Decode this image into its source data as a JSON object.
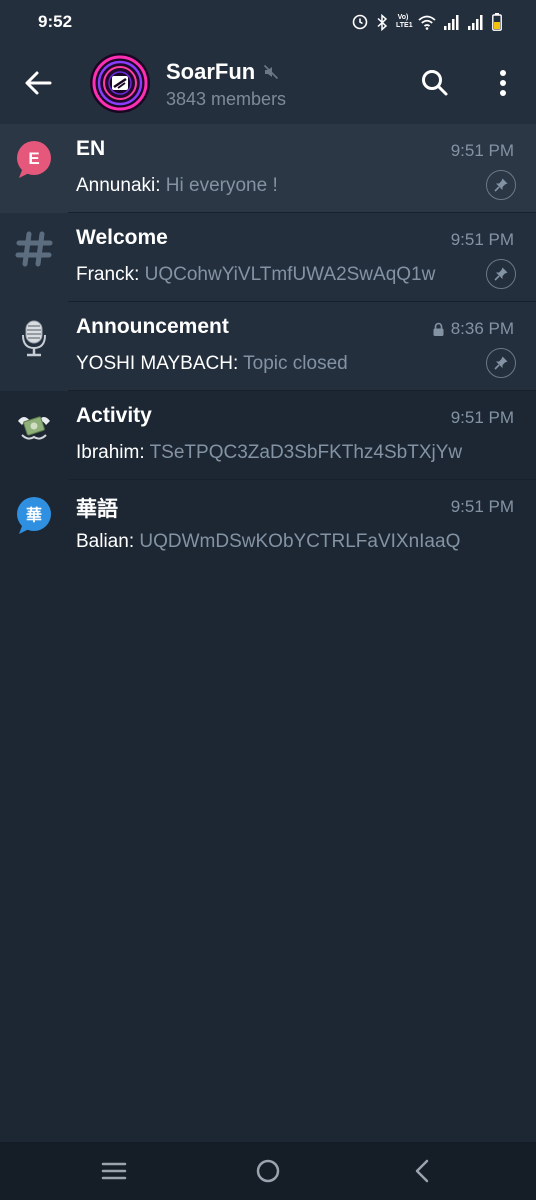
{
  "status": {
    "time": "9:52",
    "volte_top": "Vo)",
    "volte_bottom": "LTE1",
    "battery_color": "#f4c20d"
  },
  "header": {
    "title": "SoarFun",
    "subtitle": "3843 members",
    "muted": true
  },
  "topics": [
    {
      "name": "EN",
      "time": "9:51 PM",
      "sender": "Annunaki:",
      "message": "Hi everyone !",
      "icon": "letter-bubble-icon",
      "icon_letter": "E",
      "icon_color": "#e5587c",
      "pinned": true,
      "locked": false
    },
    {
      "name": "Welcome",
      "time": "9:51 PM",
      "sender": "Franck:",
      "message": "UQCohwYiVLTmfUWA2SwAqQ1w",
      "icon": "hashtag-icon",
      "pinned": true,
      "locked": false
    },
    {
      "name": "Announcement",
      "time": "8:36 PM",
      "sender": "YOSHI MAYBACH:",
      "message": "Topic closed",
      "icon": "microphone-icon",
      "pinned": true,
      "locked": true
    },
    {
      "name": "Activity",
      "time": "9:51 PM",
      "sender": "Ibrahim:",
      "message": "TSeTPQC3ZaD3SbFKThz4SbTXjYw",
      "icon": "money-wings-icon",
      "pinned": false,
      "locked": false
    },
    {
      "name": "華語",
      "time": "9:51 PM",
      "sender": "Balian:",
      "message": "UQDWmDSwKObYCTRLFaVIXnIaaQ",
      "icon": "letter-bubble-icon",
      "icon_letter": "華",
      "icon_color": "#2f8fe0",
      "pinned": false,
      "locked": false
    }
  ]
}
